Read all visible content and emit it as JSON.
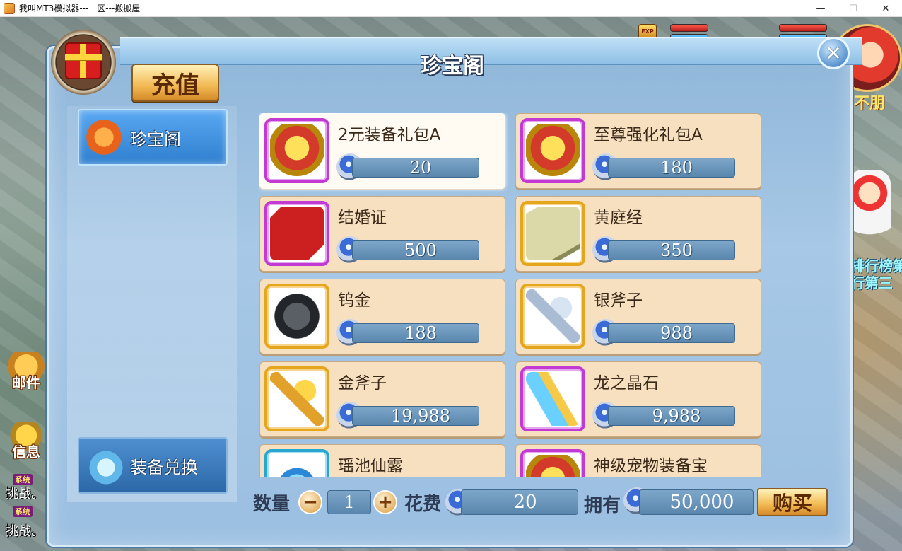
{
  "window": {
    "title": "我叫MT3模拟器---一区---搬搬屋",
    "minimize": "—",
    "maximize": "☐",
    "close": "✕"
  },
  "hud": {
    "exp_badge": "EXP",
    "rank_line1": "排行榜第",
    "rank_line2": "行第三",
    "banner": "不朋"
  },
  "side": {
    "mail": "邮件",
    "message": "信息",
    "chat": [
      {
        "tag": "系统",
        "text": "挑战。"
      },
      {
        "tag": "系统",
        "text": "挑战。"
      }
    ]
  },
  "panel": {
    "title": "珍宝阁",
    "close_label": "✕",
    "recharge": "充值"
  },
  "tabs": [
    {
      "label": "珍宝阁",
      "active": true
    },
    {
      "label": "装备兑换",
      "active": false
    }
  ],
  "items": [
    {
      "name": "2元装备礼包A",
      "price": "20",
      "frame": "purple",
      "art": "chest"
    },
    {
      "name": "至尊强化礼包A",
      "price": "180",
      "frame": "purple",
      "art": "chest"
    },
    {
      "name": "结婚证",
      "price": "500",
      "frame": "purple",
      "art": "cert"
    },
    {
      "name": "黄庭经",
      "price": "350",
      "frame": "gold",
      "art": "book"
    },
    {
      "name": "钨金",
      "price": "188",
      "frame": "gold",
      "art": "ore"
    },
    {
      "name": "银斧子",
      "price": "988",
      "frame": "gold",
      "art": "axe-s"
    },
    {
      "name": "金斧子",
      "price": "19,988",
      "frame": "gold",
      "art": "axe-g"
    },
    {
      "name": "龙之晶石",
      "price": "9,988",
      "frame": "purple",
      "art": "crystal"
    },
    {
      "name": "瑶池仙露",
      "price": "",
      "frame": "cyan",
      "art": "vial"
    },
    {
      "name": "神级宠物装备宝",
      "price": "",
      "frame": "purple",
      "art": "chest"
    }
  ],
  "footer": {
    "quantity_label": "数量",
    "minus": "−",
    "quantity": "1",
    "plus": "+",
    "cost_label": "花费",
    "cost": "20",
    "owned_label": "拥有",
    "owned": "50,000",
    "buy": "购买"
  }
}
